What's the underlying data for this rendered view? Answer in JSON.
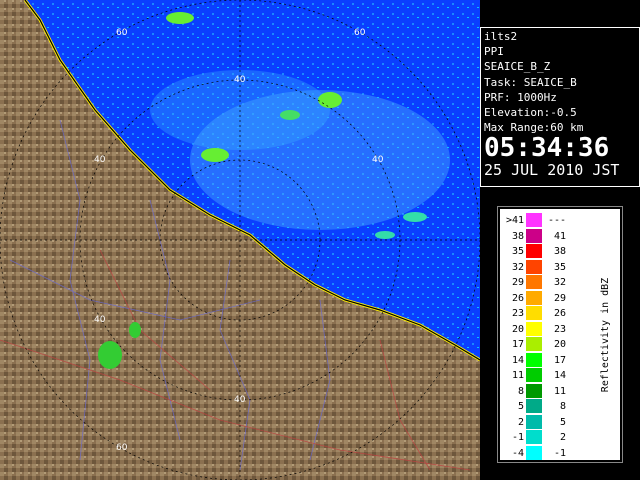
{
  "radar": {
    "ring_labels": [
      "60",
      "60",
      "40",
      "40",
      "40",
      "40",
      "40",
      "60"
    ]
  },
  "info": {
    "site": "ilts2",
    "product": "PPI",
    "field": "SEAICE_B_Z",
    "task": "Task: SEAICE_B",
    "prf": "PRF: 1000Hz",
    "elevation": "Elevation:-0.5",
    "max_range": "Max Range:60 km",
    "time": "05:34:36",
    "date": "25 JUL 2010 JST"
  },
  "legend": {
    "title": "Reflectivity in dBZ",
    "rows": [
      {
        "lo": ">41",
        "hi": "---",
        "color": "#ff33ff"
      },
      {
        "lo": "38",
        "hi": "41",
        "color": "#cc0088"
      },
      {
        "lo": "35",
        "hi": "38",
        "color": "#ff0000"
      },
      {
        "lo": "32",
        "hi": "35",
        "color": "#ff4400"
      },
      {
        "lo": "29",
        "hi": "32",
        "color": "#ff7700"
      },
      {
        "lo": "26",
        "hi": "29",
        "color": "#ffaa00"
      },
      {
        "lo": "23",
        "hi": "26",
        "color": "#ffdd00"
      },
      {
        "lo": "20",
        "hi": "23",
        "color": "#ffff00"
      },
      {
        "lo": "17",
        "hi": "20",
        "color": "#aaee00"
      },
      {
        "lo": "14",
        "hi": "17",
        "color": "#00ff00"
      },
      {
        "lo": "11",
        "hi": "14",
        "color": "#00cc00"
      },
      {
        "lo": "8",
        "hi": "11",
        "color": "#009900"
      },
      {
        "lo": "5",
        "hi": "8",
        "color": "#00aa88"
      },
      {
        "lo": "2",
        "hi": "5",
        "color": "#00bbaa"
      },
      {
        "lo": "-1",
        "hi": "2",
        "color": "#00ddcc"
      },
      {
        "lo": "-4",
        "hi": "-1",
        "color": "#00ffff"
      }
    ]
  },
  "colors": {
    "sea": "#0a3fff",
    "land": "#8b7355",
    "coast": "#000000"
  }
}
